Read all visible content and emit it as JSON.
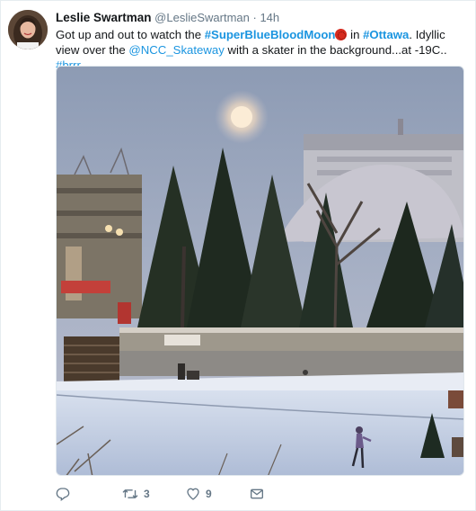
{
  "tweet": {
    "author_name": "Leslie Swartman",
    "author_handle": "@LeslieSwartman",
    "separator": "·",
    "time": "14h",
    "text_parts": {
      "p1": "Got up and out to watch the ",
      "hashtag1": "#SuperBlueBloodMoon",
      "p2": " in ",
      "hashtag2": "#Ottawa",
      "p3": ". Idyllic view over the ",
      "mention": "@NCC_Skateway",
      "p4": " with a skater in the background...at -19C.. ",
      "hashtag3": "#brrr"
    },
    "emoji": "red-moon-emoji"
  },
  "actions": {
    "reply_count": "",
    "retweet_count": "3",
    "like_count": "9"
  },
  "colors": {
    "link": "#1b95e0",
    "secondary_text": "#657786",
    "primary_text": "#14171a"
  },
  "icons": [
    "reply-icon",
    "retweet-icon",
    "like-icon",
    "direct-message-icon"
  ]
}
